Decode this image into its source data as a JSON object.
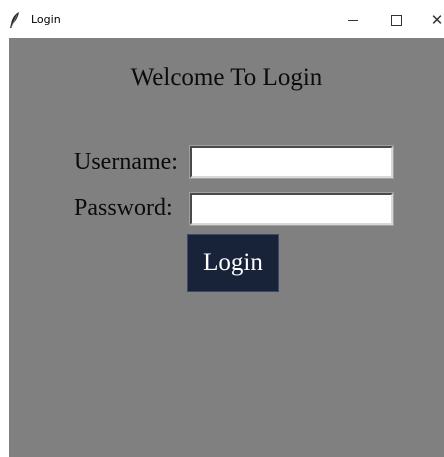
{
  "window": {
    "title": "Login",
    "icon": "feather-icon",
    "controls": {
      "minimize_icon": "minimize-icon",
      "maximize_icon": "maximize-icon",
      "close_icon": "close-icon",
      "close_glyph": "✕"
    }
  },
  "form": {
    "heading": "Welcome To Login",
    "username_label": "Username:",
    "username_value": "",
    "password_label": "Password:",
    "password_value": "",
    "login_label": "Login"
  },
  "colors": {
    "client_background": "#808080",
    "button_background": "#182238",
    "button_text": "#ffffff",
    "field_background": "#ffffff"
  }
}
